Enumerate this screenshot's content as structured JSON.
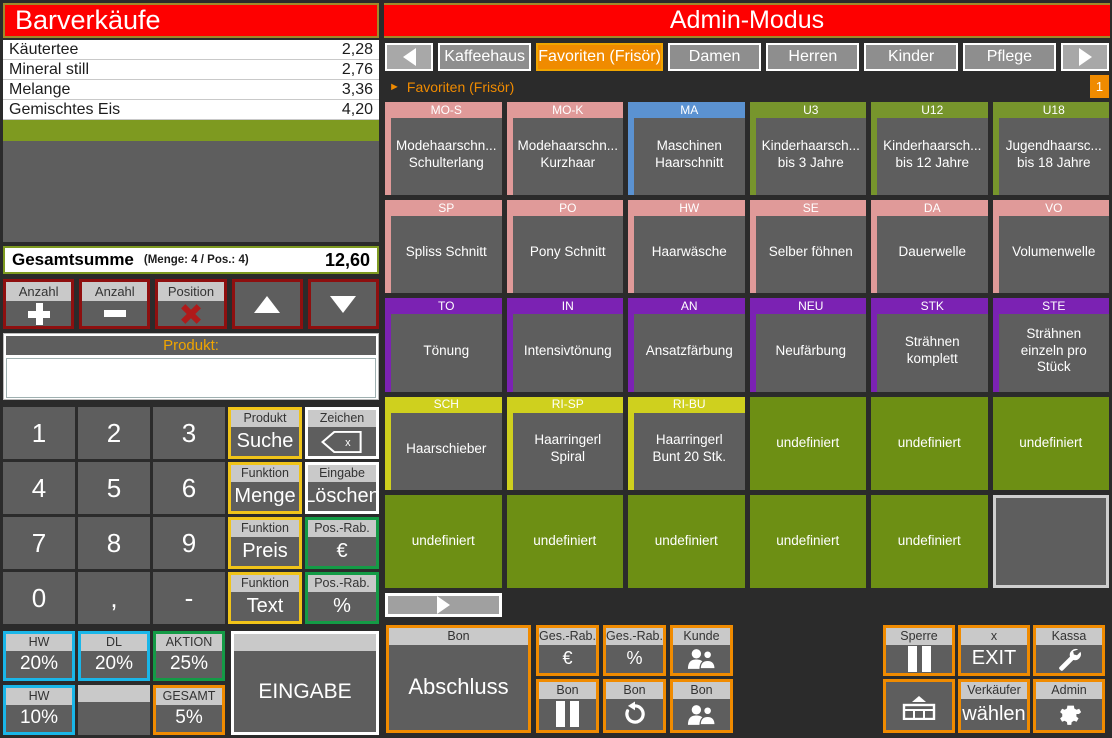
{
  "left": {
    "title": "Barverkäufe",
    "receipt_items": [
      {
        "name": "Käutertee",
        "price": "2,28"
      },
      {
        "name": "Mineral still",
        "price": "2,76"
      },
      {
        "name": "Melange",
        "price": "3,36"
      },
      {
        "name": "Gemischtes Eis",
        "price": "4,20"
      }
    ],
    "total": {
      "label": "Gesamtsumme",
      "meta": "(Menge: 4 / Pos.: 4)",
      "amount": "12,60"
    },
    "controls": [
      {
        "cap": "Anzahl",
        "icon": "plus-icon",
        "name": "quantity-increase-button"
      },
      {
        "cap": "Anzahl",
        "icon": "minus-icon",
        "name": "quantity-decrease-button"
      },
      {
        "cap": "Position",
        "icon": "delete-x-icon",
        "name": "position-delete-button"
      },
      {
        "cap": "",
        "icon": "triangle-up-icon",
        "name": "move-up-button"
      },
      {
        "cap": "",
        "icon": "triangle-down-icon",
        "name": "move-down-button"
      }
    ],
    "product_input": {
      "label": "Produkt:",
      "value": "",
      "placeholder": ""
    },
    "keypad": {
      "digits": [
        "1",
        "2",
        "3",
        "4",
        "5",
        "6",
        "7",
        "8",
        "9",
        "0",
        ",",
        "-"
      ],
      "functions": [
        {
          "cap": "Produkt",
          "label": "Suche",
          "border": "yellow",
          "name": "product-search-button"
        },
        {
          "cap": "Zeichen",
          "label": "",
          "border": "white",
          "icon": "backspace-icon",
          "name": "backspace-button"
        },
        {
          "cap": "Funktion",
          "label": "Menge",
          "border": "yellow",
          "name": "function-quantity-button"
        },
        {
          "cap": "Eingabe",
          "label": "Löschen",
          "border": "white",
          "name": "clear-input-button"
        },
        {
          "cap": "Funktion",
          "label": "Preis",
          "border": "yellow",
          "name": "function-price-button"
        },
        {
          "cap": "Pos.-Rab.",
          "label": "€",
          "border": "green",
          "name": "position-discount-euro-button"
        },
        {
          "cap": "Funktion",
          "label": "Text",
          "border": "yellow",
          "name": "function-text-button"
        },
        {
          "cap": "Pos.-Rab.",
          "label": "%",
          "border": "green",
          "name": "position-discount-percent-button"
        }
      ]
    },
    "discounts": [
      {
        "cap": "HW",
        "label": "20%",
        "border": "cyan",
        "name": "discount-hw-20-button"
      },
      {
        "cap": "DL",
        "label": "20%",
        "border": "cyan",
        "name": "discount-dl-20-button"
      },
      {
        "cap": "AKTION",
        "label": "25%",
        "border": "green",
        "name": "discount-aktion-25-button"
      },
      {
        "cap": "HW",
        "label": "10%",
        "border": "cyan",
        "name": "discount-hw-10-button"
      },
      {
        "cap": "",
        "label": "",
        "border": "none",
        "name": "discount-empty-button"
      },
      {
        "cap": "GESAMT",
        "label": "5%",
        "border": "orange",
        "name": "discount-gesamt-5-button"
      }
    ],
    "enter_button": {
      "label": "EINGABE"
    }
  },
  "right": {
    "mode_title": "Admin-Modus",
    "tabs": [
      {
        "label": "",
        "icon": "arrow-left-icon",
        "kind": "arrow",
        "name": "tab-prev-button"
      },
      {
        "label": "Kaffeehaus",
        "kind": "named",
        "active": false
      },
      {
        "label": "Favoriten (Frisör)",
        "kind": "named",
        "active": true
      },
      {
        "label": "Damen",
        "kind": "named",
        "active": false
      },
      {
        "label": "Herren",
        "kind": "named",
        "active": false
      },
      {
        "label": "Kinder",
        "kind": "named",
        "active": false
      },
      {
        "label": "Pflege",
        "kind": "named",
        "active": false
      },
      {
        "label": "",
        "icon": "arrow-right-icon",
        "kind": "arrow",
        "name": "tab-next-button"
      }
    ],
    "breadcrumb": {
      "text": "Favoriten (Frisör)",
      "page": "1"
    },
    "grid": [
      {
        "code": "MO-S",
        "lines": [
          "Modehaarschn...",
          "Schulterlang"
        ],
        "color": "#e09a99",
        "type": "product"
      },
      {
        "code": "MO-K",
        "lines": [
          "Modehaarschn...",
          "Kurzhaar"
        ],
        "color": "#e09a99",
        "type": "product"
      },
      {
        "code": "MA",
        "lines": [
          "Maschinen",
          "Haarschnitt"
        ],
        "color": "#5b92d1",
        "type": "product"
      },
      {
        "code": "U3",
        "lines": [
          "Kinderhaarsch...",
          "bis 3 Jahre"
        ],
        "color": "#77952c",
        "type": "product"
      },
      {
        "code": "U12",
        "lines": [
          "Kinderhaarsch...",
          "bis 12 Jahre"
        ],
        "color": "#77952c",
        "type": "product"
      },
      {
        "code": "U18",
        "lines": [
          "Jugendhaarsc...",
          "bis 18 Jahre"
        ],
        "color": "#77952c",
        "type": "product"
      },
      {
        "code": "SP",
        "lines": [
          "Spliss Schnitt"
        ],
        "color": "#e09a99",
        "type": "product"
      },
      {
        "code": "PO",
        "lines": [
          "Pony Schnitt"
        ],
        "color": "#e09a99",
        "type": "product"
      },
      {
        "code": "HW",
        "lines": [
          "Haarwäsche"
        ],
        "color": "#e09a99",
        "type": "product"
      },
      {
        "code": "SE",
        "lines": [
          "Selber föhnen"
        ],
        "color": "#e09a99",
        "type": "product"
      },
      {
        "code": "DA",
        "lines": [
          "Dauerwelle"
        ],
        "color": "#e09a99",
        "type": "product"
      },
      {
        "code": "VO",
        "lines": [
          "Volumenwelle"
        ],
        "color": "#e09a99",
        "type": "product"
      },
      {
        "code": "TO",
        "lines": [
          "Tönung"
        ],
        "color": "#7b22b3",
        "type": "product"
      },
      {
        "code": "IN",
        "lines": [
          "Intensivtönung"
        ],
        "color": "#7b22b3",
        "type": "product"
      },
      {
        "code": "AN",
        "lines": [
          "Ansatzfärbung"
        ],
        "color": "#7b22b3",
        "type": "product"
      },
      {
        "code": "NEU",
        "lines": [
          "Neufärbung"
        ],
        "color": "#7b22b3",
        "type": "product"
      },
      {
        "code": "STK",
        "lines": [
          "Strähnen",
          "komplett"
        ],
        "color": "#7b22b3",
        "type": "product"
      },
      {
        "code": "STE",
        "lines": [
          "Strähnen",
          "einzeln pro",
          "Stück"
        ],
        "color": "#7b22b3",
        "type": "product"
      },
      {
        "code": "SCH",
        "lines": [
          "Haarschieber"
        ],
        "color": "#cfd01e",
        "type": "product"
      },
      {
        "code": "RI-SP",
        "lines": [
          "Haarringerl",
          "Spiral"
        ],
        "color": "#cfd01e",
        "type": "product"
      },
      {
        "code": "RI-BU",
        "lines": [
          "Haarringerl",
          "Bunt 20 Stk."
        ],
        "color": "#cfd01e",
        "type": "product"
      },
      {
        "code": "",
        "lines": [
          "undefiniert"
        ],
        "type": "undefined"
      },
      {
        "code": "",
        "lines": [
          "undefiniert"
        ],
        "type": "undefined"
      },
      {
        "code": "",
        "lines": [
          "undefiniert"
        ],
        "type": "undefined"
      },
      {
        "code": "",
        "lines": [
          "undefiniert"
        ],
        "type": "undefined"
      },
      {
        "code": "",
        "lines": [
          "undefiniert"
        ],
        "type": "undefined"
      },
      {
        "code": "",
        "lines": [
          "undefiniert"
        ],
        "type": "undefined"
      },
      {
        "code": "",
        "lines": [
          "undefiniert"
        ],
        "type": "undefined"
      },
      {
        "code": "",
        "lines": [
          "undefiniert"
        ],
        "type": "undefined"
      },
      {
        "code": "",
        "lines": [
          ""
        ],
        "type": "blank"
      },
      {
        "code": "",
        "lines": [
          ""
        ],
        "type": "nav-next",
        "icon": "arrow-right-icon"
      }
    ],
    "bottom": {
      "abschluss": {
        "cap": "Bon",
        "label": "Abschluss",
        "name": "receipt-finish-button"
      },
      "buttons": [
        {
          "cap": "Ges.-Rab.",
          "label": "€",
          "name": "total-discount-euro-button"
        },
        {
          "cap": "Ges.-Rab.",
          "label": "%",
          "name": "total-discount-percent-button"
        },
        {
          "cap": "Kunde",
          "label": "",
          "icon": "customer-icon",
          "name": "customer-button"
        },
        {
          "cap": "Bon",
          "label": "",
          "icon": "pause-icon",
          "name": "receipt-park-button"
        },
        {
          "cap": "Bon",
          "label": "",
          "icon": "undo-icon",
          "name": "receipt-undo-button"
        },
        {
          "cap": "Bon",
          "label": "",
          "icon": "customer-icon",
          "name": "receipt-customer-button"
        }
      ],
      "right_buttons": [
        {
          "cap": "Sperre",
          "label": "",
          "icon": "pause-icon",
          "name": "lock-button"
        },
        {
          "cap": "x",
          "label": "EXIT",
          "name": "exit-button"
        },
        {
          "cap": "Kassa",
          "label": "",
          "icon": "wrench-icon",
          "name": "register-settings-button"
        },
        {
          "cap": "",
          "label": "",
          "icon": "cash-drawer-icon",
          "name": "cash-drawer-button"
        },
        {
          "cap": "Verkäufer",
          "label": "wählen",
          "name": "select-seller-button"
        },
        {
          "cap": "Admin",
          "label": "",
          "icon": "gear-icon",
          "name": "admin-settings-button"
        }
      ]
    }
  },
  "colors": {
    "accent_red": "#fe0000",
    "accent_orange": "#f08b00",
    "key_gray": "#5e5e5e",
    "cap_gray": "#c9c9c9",
    "green_row": "#7e9a20",
    "undefined_green": "#6d8f14",
    "bg": "#2b2b2b"
  }
}
